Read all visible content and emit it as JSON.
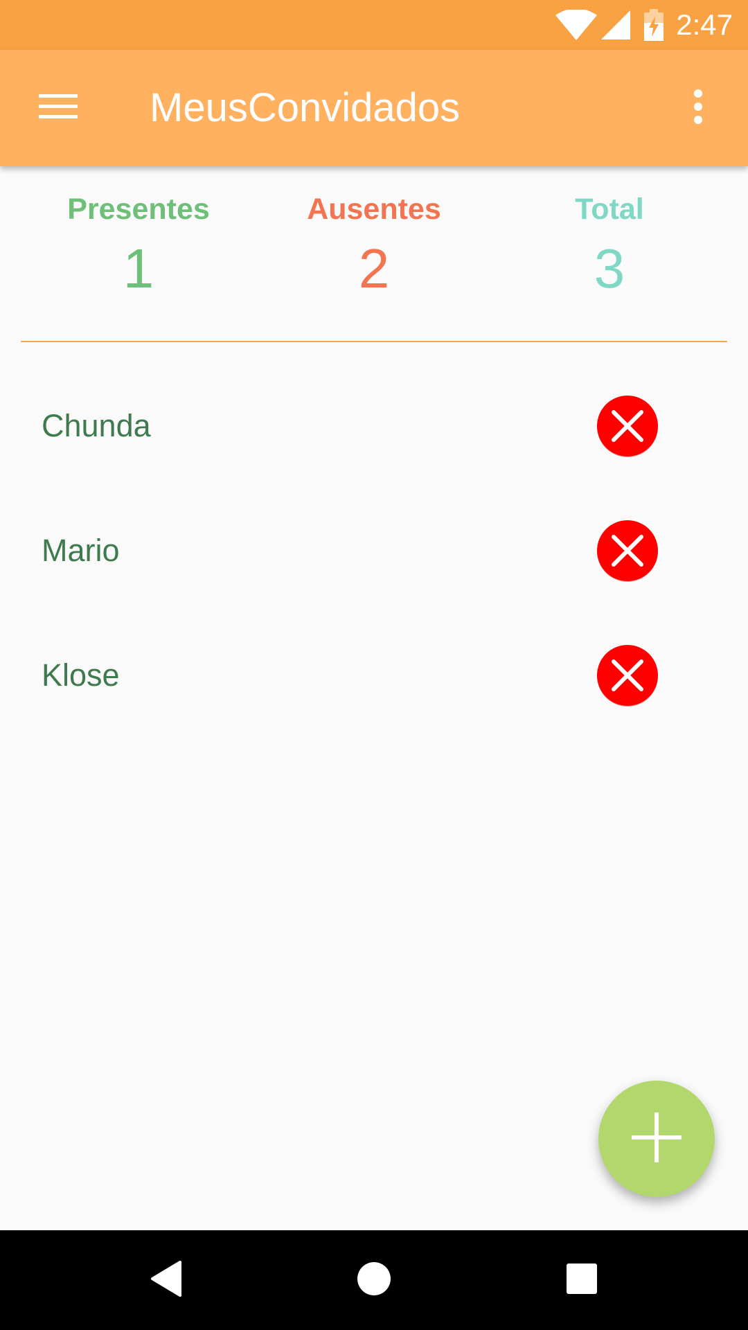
{
  "status_bar": {
    "time": "2:47",
    "icons": [
      "wifi-icon",
      "cell-signal-icon",
      "battery-charging-icon"
    ],
    "color": "#F9A244"
  },
  "app_bar": {
    "title": "MeusConvidados",
    "menu_icon": "hamburger-menu-icon",
    "overflow_icon": "more-vert-icon",
    "color": "#FFB160"
  },
  "stats": {
    "present": {
      "label": "Presentes",
      "value": "1",
      "color": "#6EBF7A"
    },
    "absent": {
      "label": "Ausentes",
      "value": "2",
      "color": "#F27451"
    },
    "total": {
      "label": "Total",
      "value": "3",
      "color": "#7FD8C6"
    }
  },
  "guests": [
    {
      "name": "Chunda",
      "status": "absent",
      "status_icon": "absent-x-icon"
    },
    {
      "name": "Mario",
      "status": "absent",
      "status_icon": "absent-x-icon"
    },
    {
      "name": "Klose",
      "status": "absent",
      "status_icon": "absent-x-icon"
    }
  ],
  "fab": {
    "icon": "add-icon",
    "color": "#B1D76D"
  },
  "nav_bar": {
    "icons": [
      "back-icon",
      "home-icon",
      "recents-icon"
    ]
  },
  "colors": {
    "guest_name": "#3E7A4D",
    "absent_red": "#FF0000",
    "divider": "#F6A655"
  }
}
